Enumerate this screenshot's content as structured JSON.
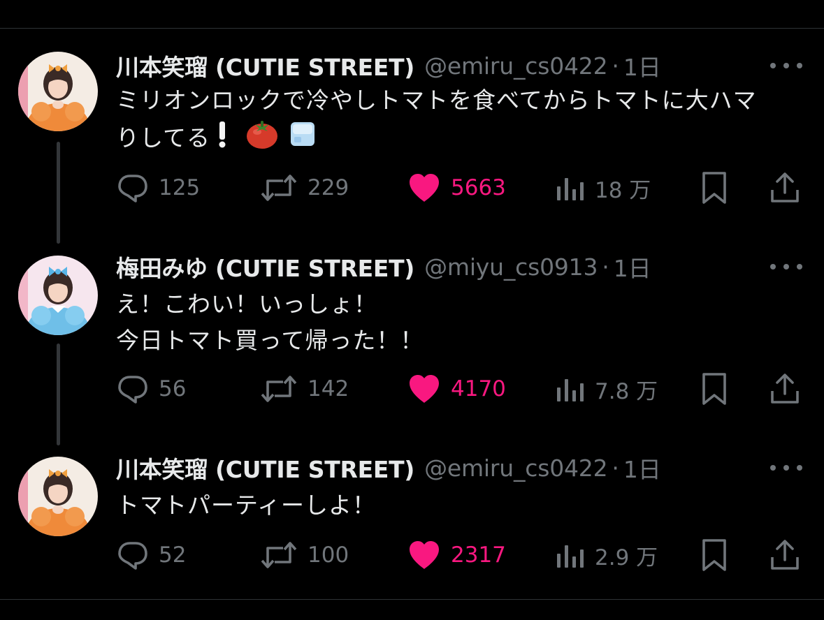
{
  "colors": {
    "background": "#000000",
    "text": "#e7e9ea",
    "muted": "#71767b",
    "like": "#f91880",
    "divider": "#2f3336"
  },
  "tweets": [
    {
      "name": "川本笑瑠 (CUTIE STREET)",
      "handle": "@emiru_cs0422",
      "separator": "·",
      "time": "1日",
      "body": [
        "ミリオンロックで冷やしトマトを食べてからトマトに大ハマ",
        "りしてる"
      ],
      "emoji": [
        "exclamation-emoji",
        "tomato-emoji",
        "ice-cube-emoji"
      ],
      "avatar": "avatar-emiru",
      "replies": "125",
      "reposts": "229",
      "likes": "5663",
      "views": "18 万",
      "liked": true
    },
    {
      "name": "梅田みゆ (CUTIE STREET)",
      "handle": "@miyu_cs0913",
      "separator": "·",
      "time": "1日",
      "body": [
        "え！こわい！いっしょ！",
        "今日トマト買って帰った！！"
      ],
      "avatar": "avatar-miyu",
      "replies": "56",
      "reposts": "142",
      "likes": "4170",
      "views": "7.8 万",
      "liked": true
    },
    {
      "name": "川本笑瑠 (CUTIE STREET)",
      "handle": "@emiru_cs0422",
      "separator": "·",
      "time": "1日",
      "body": [
        "トマトパーティーしよ！"
      ],
      "avatar": "avatar-emiru",
      "replies": "52",
      "reposts": "100",
      "likes": "2317",
      "views": "2.9 万",
      "liked": true
    }
  ]
}
